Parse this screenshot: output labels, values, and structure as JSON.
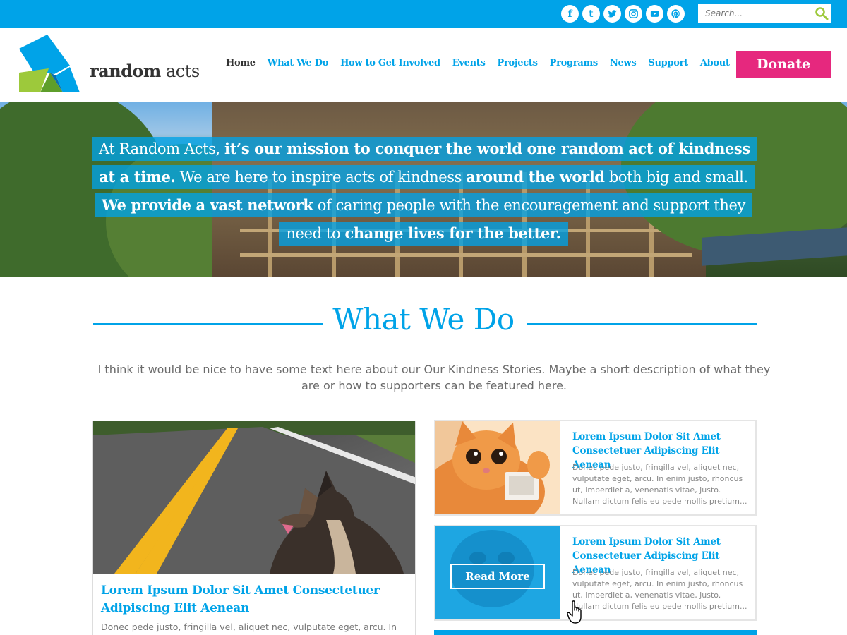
{
  "topbar": {
    "social": [
      {
        "icon": "facebook-icon",
        "glyph": "f"
      },
      {
        "icon": "tumblr-icon",
        "glyph": "t"
      },
      {
        "icon": "twitter-icon",
        "glyph": ""
      },
      {
        "icon": "instagram-icon",
        "glyph": ""
      },
      {
        "icon": "youtube-icon",
        "glyph": ""
      },
      {
        "icon": "pinterest-icon",
        "glyph": ""
      }
    ],
    "search_placeholder": "Search..."
  },
  "header": {
    "logo_word1": "random",
    "logo_word2": "acts",
    "nav": [
      "Home",
      "What We Do",
      "How to Get Involved",
      "Events",
      "Projects",
      "Programs",
      "News",
      "Support",
      "About"
    ],
    "active_nav": "Home",
    "donate_label": "Donate"
  },
  "hero": {
    "line1_a": "At Random Acts, ",
    "line1_b": "it’s our mission to conquer the world one random act of kindness",
    "line2_a": "at a time.",
    "line2_b": " We are here to inspire acts of kindness ",
    "line2_c": "around the world",
    "line2_d": " both big and small.",
    "line3_a": "We provide a vast network",
    "line3_b": " of caring people with the encouragement and support they",
    "line4_a": "need to ",
    "line4_b": "change lives for the better."
  },
  "what_we_do": {
    "title": "What We Do",
    "intro": "I think it would be nice to have some text here about our Our Kindness Stories. Maybe a short description of what they are or how to supporters can be featured here.",
    "feature": {
      "title": "Lorem Ipsum Dolor Sit Amet Consectetuer Adipiscing Elit Aenean",
      "text": "Donec pede justo, fringilla vel, aliquet nec, vulputate eget, arcu. In"
    },
    "cards": [
      {
        "title": "Lorem Ipsum Dolor Sit Amet Consectetuer Adipiscing Elit Aenean",
        "text": "Donec pede justo, fringilla vel, aliquet nec, vulputate eget, arcu. In enim justo, rhoncus ut, imperdiet a, venenatis vitae, justo. Nullam dictum felis eu pede mollis pretium..."
      },
      {
        "title": "Lorem Ipsum Dolor Sit Amet Consectetuer Adipiscing Elit Aenean",
        "text": "Donec pede justo, fringilla vel, aliquet nec, vulputate eget, arcu. In enim justo, rhoncus ut, imperdiet a, venenatis vitae, justo. Nullam dictum felis eu pede mollis pretium...",
        "read_more": "Read More"
      }
    ]
  },
  "colors": {
    "brand_blue": "#00a3e8",
    "donate_pink": "#e6287e",
    "logo_green": "#9dc93b"
  }
}
